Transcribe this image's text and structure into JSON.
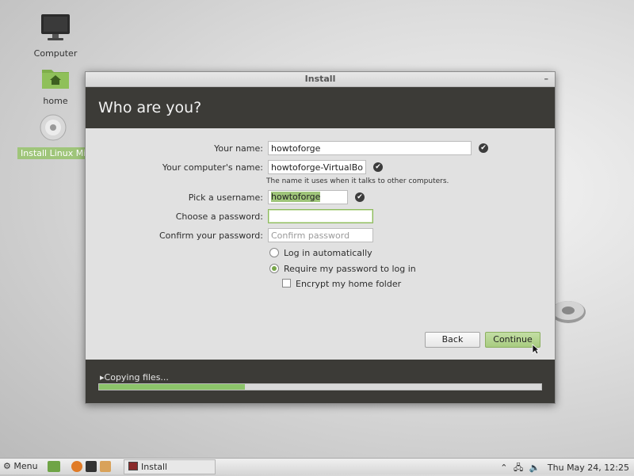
{
  "desktop": {
    "icons": [
      {
        "label": "Computer"
      },
      {
        "label": "home"
      },
      {
        "label": "Install Linux Mi"
      }
    ]
  },
  "window": {
    "title": "Install",
    "minimize_glyph": "–",
    "header": "Who are you?",
    "form": {
      "name_label": "Your name:",
      "name_value": "howtoforge",
      "computer_label": "Your computer's name:",
      "computer_value": "howtoforge-VirtualBox",
      "computer_hint": "The name it uses when it talks to other computers.",
      "username_label": "Pick a username:",
      "username_value": "howtoforge",
      "password_label": "Choose a password:",
      "password_value": "",
      "confirm_label": "Confirm your password:",
      "confirm_placeholder": "Confirm password",
      "login_auto": "Log in automatically",
      "login_require": "Require my password to log in",
      "encrypt": "Encrypt my home folder"
    },
    "buttons": {
      "back": "Back",
      "continue": "Continue"
    },
    "footer": {
      "status": "Copying files...",
      "progress": 0.33
    }
  },
  "taskbar": {
    "menu_label": "Menu",
    "task_label": "Install",
    "clock": "Thu May 24, 12:25"
  },
  "colors": {
    "accent": "#8cc46a",
    "dark": "#3c3b37"
  }
}
